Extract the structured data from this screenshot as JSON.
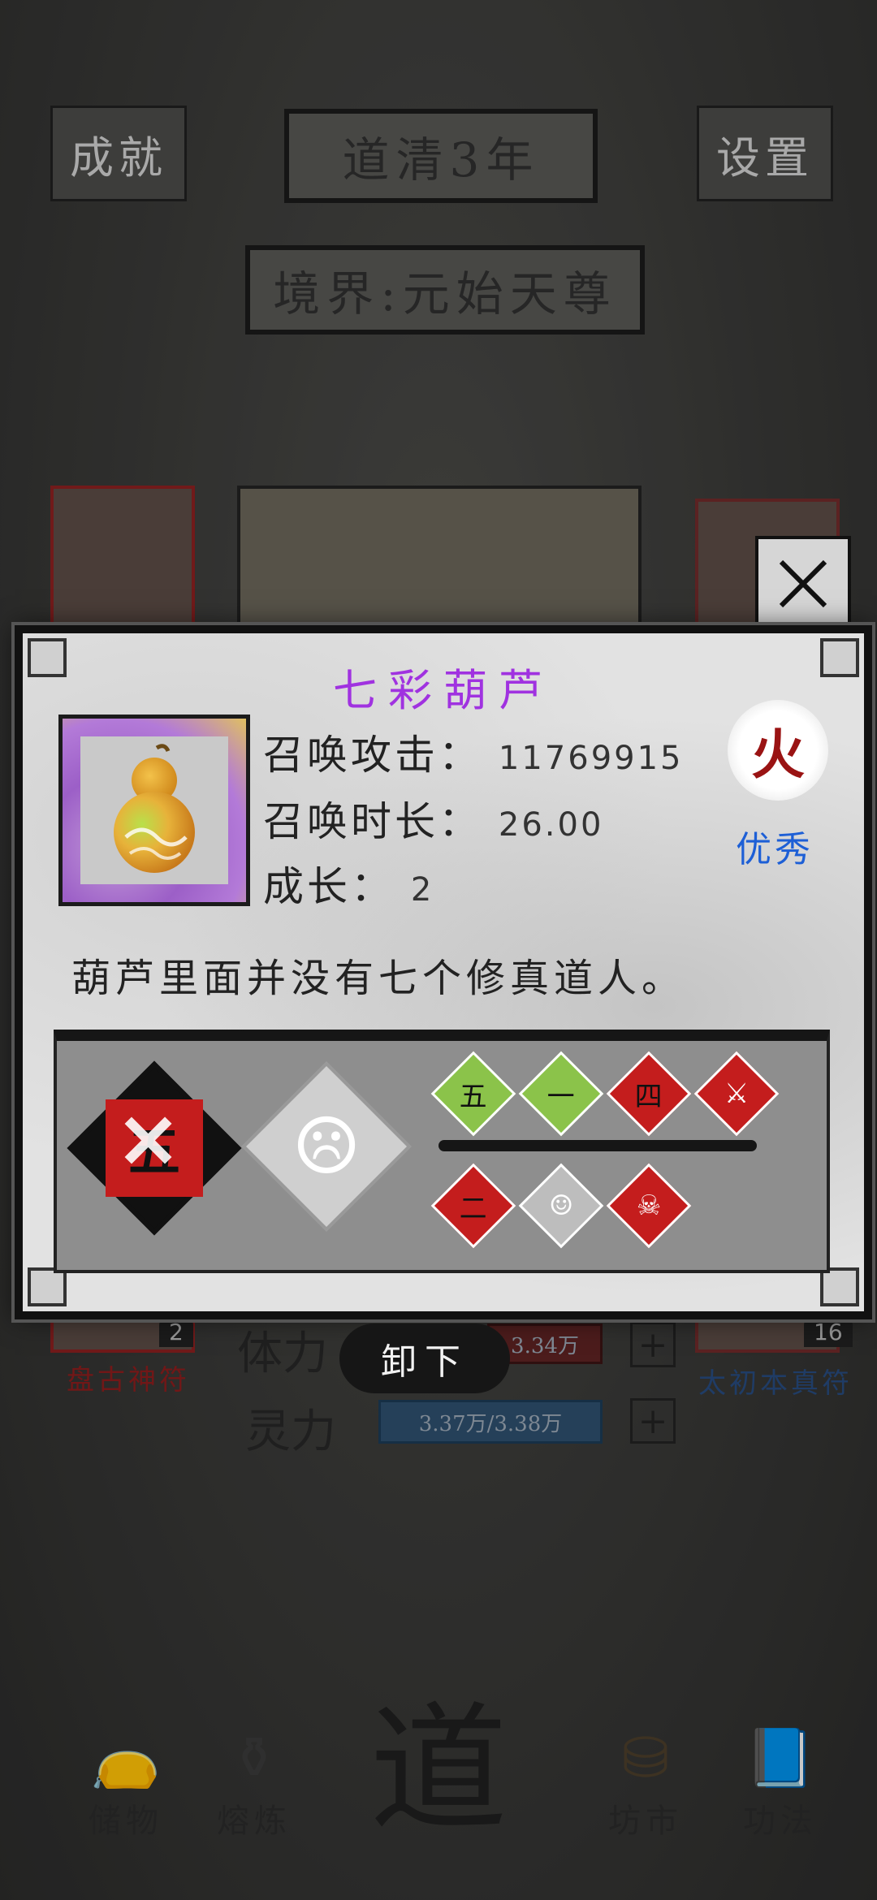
{
  "header": {
    "achievements_label": "成就",
    "year_title": "道清3年",
    "settings_label": "设置",
    "realm_label": "境界:元始天尊"
  },
  "equipment": {
    "left_slot": {
      "name": "盘古神符",
      "count": "2"
    },
    "right_slot": {
      "name": "太初本真符",
      "count": "16"
    }
  },
  "stats": {
    "stamina_label": "体力",
    "stamina_value": "3.34万",
    "spirit_label": "灵力",
    "spirit_value": "3.37万/3.38万"
  },
  "bottom_nav": {
    "storage": "储物",
    "smelting": "熔炼",
    "center": "道",
    "market": "坊市",
    "techniques": "功法"
  },
  "modal": {
    "item_name": "七彩葫芦",
    "summon_attack_label": "召唤攻击：",
    "summon_attack_value": "11769915",
    "summon_duration_label": "召唤时长：",
    "summon_duration_value": "26.00",
    "growth_label": "成长：",
    "growth_value": "2",
    "element": "火",
    "quality": "优秀",
    "description": "葫芦里面并没有七个修真道人。",
    "skills_large": [
      {
        "glyph": "五",
        "color": "#c41d1d",
        "name": "skill-five-crossed"
      },
      {
        "glyph": "☹",
        "color": "#cfcfcf",
        "name": "skill-demon-face"
      }
    ],
    "skills_small_top": [
      {
        "glyph": "五",
        "color": "#8bc34a"
      },
      {
        "glyph": "一",
        "color": "#8bc34a"
      },
      {
        "glyph": "四",
        "color": "#c41d1d"
      },
      {
        "glyph": "⚔",
        "color": "#c41d1d"
      }
    ],
    "skills_small_bottom": [
      {
        "glyph": "二",
        "color": "#c41d1d"
      },
      {
        "glyph": "☺",
        "color": "#bdbdbd"
      },
      {
        "glyph": "☠",
        "color": "#c41d1d"
      }
    ],
    "unload_label": "卸下"
  },
  "colors": {
    "title_purple": "#a032e0",
    "quality_blue": "#1d5fd6",
    "element_red": "#9a1313"
  }
}
